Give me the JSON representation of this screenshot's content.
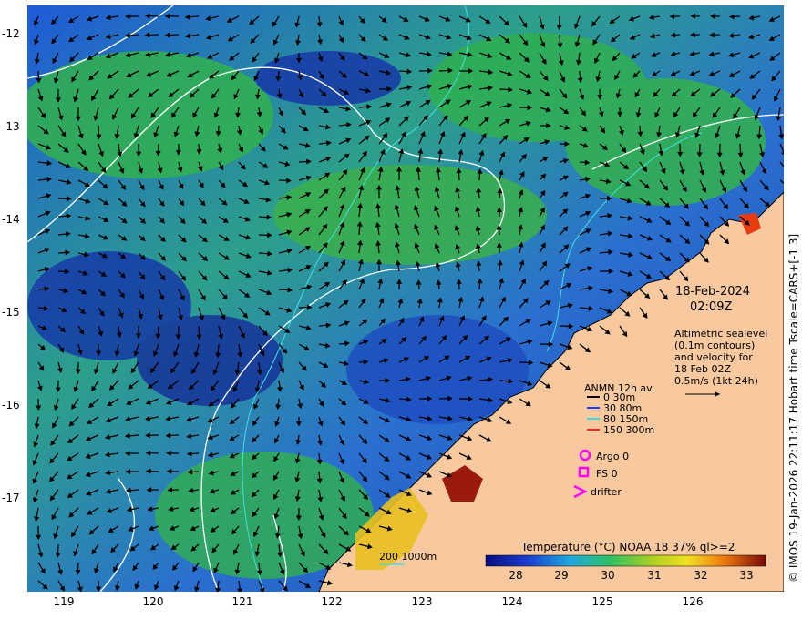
{
  "axes": {
    "y_ticks": [
      "-12",
      "-13",
      "-14",
      "-15",
      "-16",
      "-17"
    ],
    "x_ticks": [
      "119",
      "120",
      "121",
      "122",
      "123",
      "124",
      "125",
      "126"
    ]
  },
  "annotations": {
    "date": "18-Feb-2024",
    "time": "02:09Z",
    "altimetry_note": [
      "Altimetric sealevel",
      "(0.1m contours)",
      "and velocity for",
      "18 Feb 02Z",
      "0.5m/s (1kt 24h)"
    ]
  },
  "legend": {
    "title": "ANMN 12h av.",
    "depths": [
      {
        "label": "0 30m",
        "color": "#000000"
      },
      {
        "label": "30 80m",
        "color": "#1f3fff"
      },
      {
        "label": "80 150m",
        "color": "#33dddd"
      },
      {
        "label": "150 300m",
        "color": "#ff2020"
      }
    ],
    "argo": "Argo 0",
    "fs": "FS 0",
    "drifter": "drifter",
    "marker_color": "#ff00ff"
  },
  "contour_key": "200  1000m",
  "colorbar": {
    "title": "Temperature (°C) NOAA 18 37% ql>=2",
    "ticks": [
      "28",
      "29",
      "30",
      "31",
      "32",
      "33"
    ]
  },
  "credit": "© IMOS 19-Jan-2026 22:11:17 Hobart time Tscale=CARS+[-1 3]",
  "colors": {
    "land": "#f8c89e",
    "sst_cool": "#1530a0",
    "sst_mid": "#2fae4a",
    "sst_warm": "#d04010",
    "contour": "#ffffff",
    "bathy": "#40e0e0"
  }
}
